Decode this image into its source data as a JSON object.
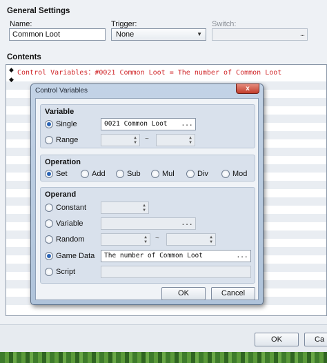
{
  "general": {
    "title": "General Settings",
    "name_label": "Name:",
    "name_value": "Common Loot",
    "trigger_label": "Trigger:",
    "trigger_value": "None",
    "switch_label": "Switch:",
    "switch_button": "..."
  },
  "contents": {
    "title": "Contents",
    "commands": [
      {
        "text": "Control Variables：#0021 Common Loot = The number of Common Loot"
      },
      {
        "text": ""
      }
    ]
  },
  "footer": {
    "ok_label": "OK",
    "cancel_label": "Ca"
  },
  "dialog": {
    "title": "Control Variables",
    "close_label": "x",
    "variable": {
      "title": "Variable",
      "single_label": "Single",
      "single_value": "0021 Common Loot",
      "range_label": "Range",
      "range_separator": "~",
      "selected": "single"
    },
    "operation": {
      "title": "Operation",
      "options": [
        "Set",
        "Add",
        "Sub",
        "Mul",
        "Div",
        "Mod"
      ],
      "selected": "Set"
    },
    "operand": {
      "title": "Operand",
      "constant_label": "Constant",
      "variable_label": "Variable",
      "random_label": "Random",
      "random_separator": "~",
      "game_data_label": "Game Data",
      "game_data_value": "The number of Common Loot",
      "script_label": "Script",
      "selected": "game_data",
      "button_dots": "..."
    },
    "ok_label": "OK",
    "cancel_label": "Cancel"
  },
  "colors": {
    "accent": "#2a64b6",
    "command_text": "#d0282b",
    "dialog_frame": "#afc3da"
  }
}
